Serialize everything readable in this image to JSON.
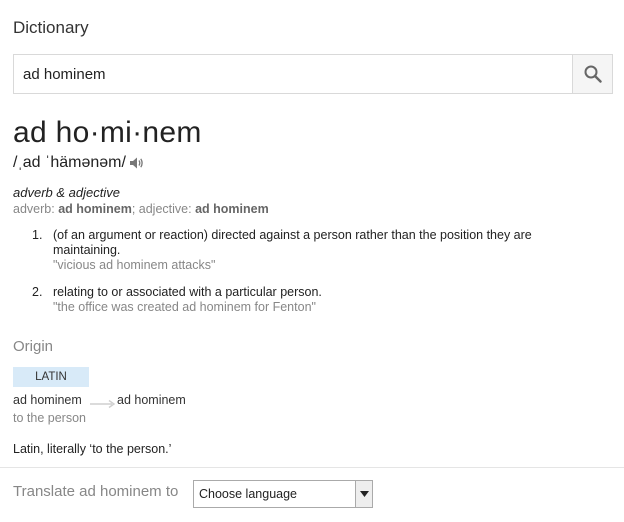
{
  "header": {
    "title": "Dictionary"
  },
  "search": {
    "value": "ad hominem",
    "placeholder": ""
  },
  "entry": {
    "headword": "ad ho·mi·nem",
    "pronunciation": "/ˌad ˈhämənəm/",
    "part_of_speech": "adverb & adjective",
    "forms": {
      "adverb_label": "adverb:",
      "adverb_value": "ad hominem",
      "sep": ";",
      "adjective_label": "adjective:",
      "adjective_value": "ad hominem"
    },
    "senses": [
      {
        "number": "1.",
        "definition": "(of an argument or reaction) directed against a person rather than the position they are maintaining.",
        "example": "\"vicious ad hominem attacks\""
      },
      {
        "number": "2.",
        "definition": "relating to or associated with a particular person.",
        "example": "\"the office was created ad hominem for Fenton\""
      }
    ]
  },
  "origin": {
    "heading": "Origin",
    "language": "LATIN",
    "source_word": "ad hominem",
    "target_word": "ad hominem",
    "gloss": "to the person",
    "note": "Latin, literally ‘to the person.’"
  },
  "translate": {
    "label": "Translate ad hominem to",
    "selected": "Choose language"
  },
  "icons": {
    "search": "search-icon",
    "speaker": "speaker-icon",
    "arrow": "arrow-right-icon",
    "dropdown": "chevron-down-icon"
  },
  "colors": {
    "muted_text": "#878787",
    "language_chip_bg": "#d8eaf8",
    "border": "#d9d9d9"
  }
}
